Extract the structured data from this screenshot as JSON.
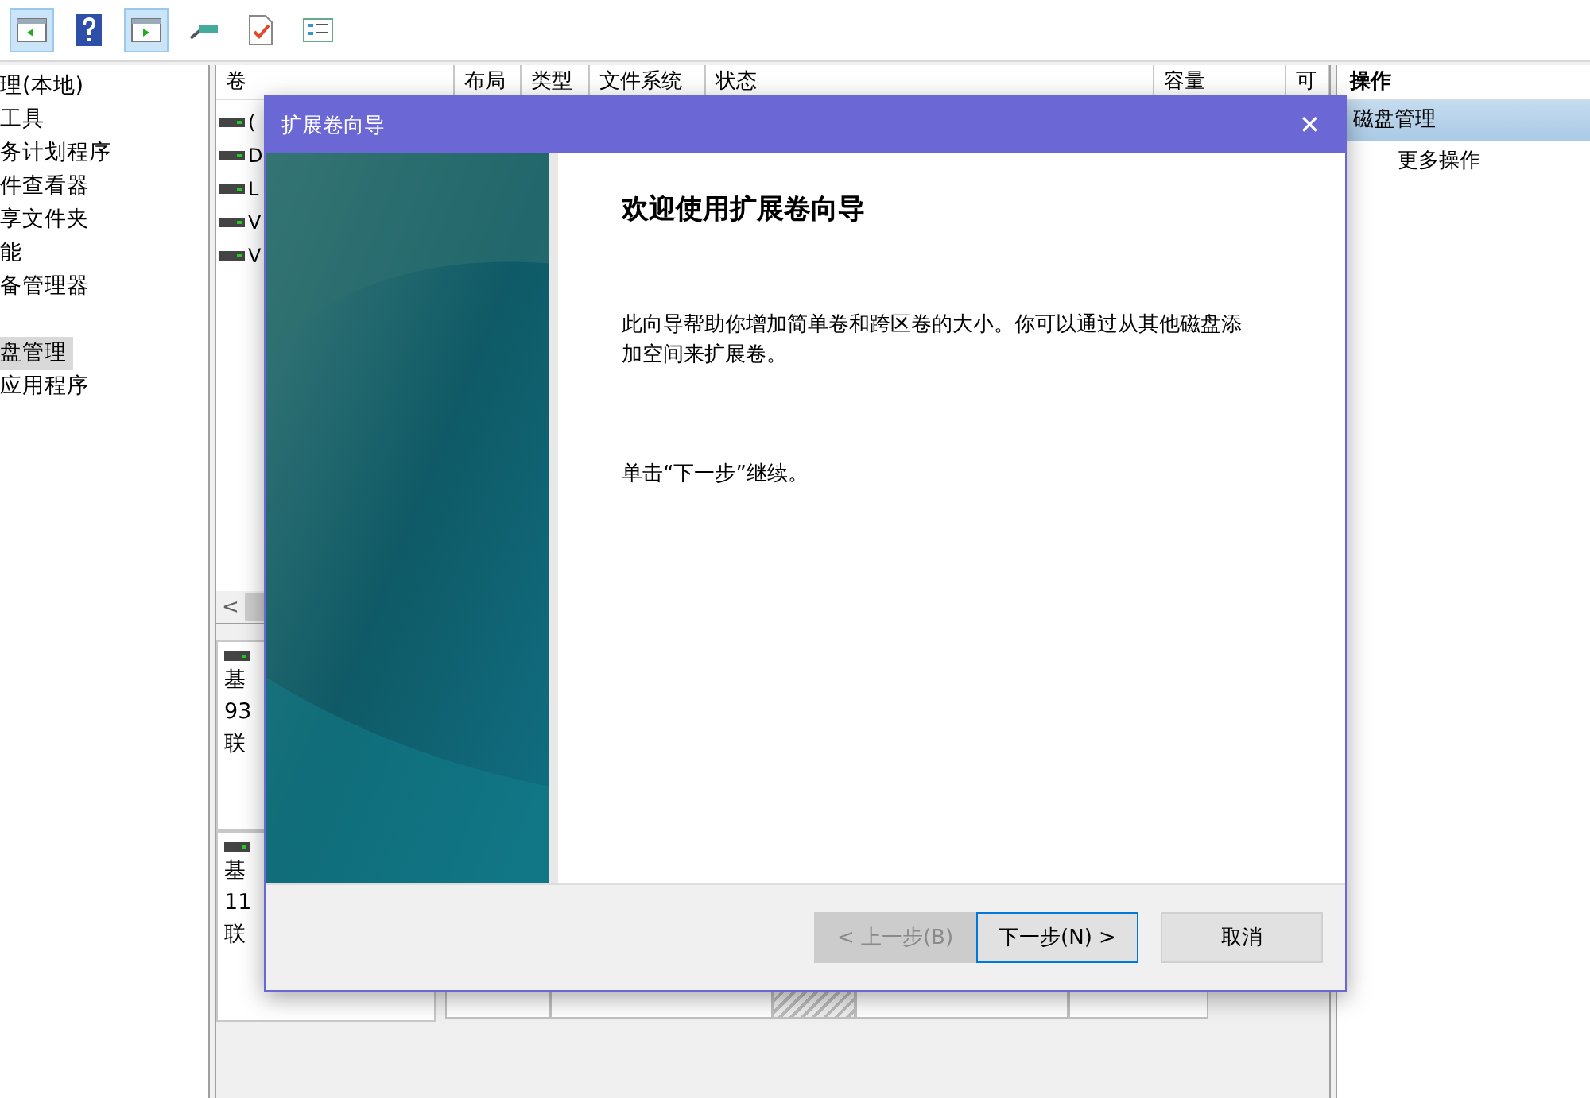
{
  "tree": {
    "groups": [
      [
        {
          "label": "理(本地)",
          "selected": false
        },
        {
          "label": "工具",
          "selected": false
        },
        {
          "label": "务计划程序",
          "selected": false
        },
        {
          "label": "件查看器",
          "selected": false
        },
        {
          "label": "享文件夹",
          "selected": false
        },
        {
          "label": "能",
          "selected": false
        },
        {
          "label": "备管理器",
          "selected": false
        }
      ],
      [
        {
          "label": "盘管理",
          "selected": true
        },
        {
          "label": "应用程序",
          "selected": false
        }
      ]
    ]
  },
  "volumes": {
    "columns": [
      "卷",
      "布局",
      "类型",
      "文件系统",
      "状态",
      "容量",
      "可"
    ],
    "rows": [
      "(",
      "D",
      "L",
      "V",
      "V"
    ],
    "scroll_left": "<"
  },
  "disks": [
    {
      "lines": [
        "基",
        "93",
        "联"
      ]
    },
    {
      "lines": [
        "基",
        "11",
        "联"
      ]
    }
  ],
  "actions": {
    "header": "操作",
    "items": [
      {
        "label": "磁盘管理",
        "selected": true
      },
      {
        "label": "更多操作",
        "selected": false
      }
    ]
  },
  "dialog": {
    "title": "扩展卷向导",
    "close": "✕",
    "heading": "欢迎使用扩展卷向导",
    "paragraphs": [
      "此向导帮助你增加简单卷和跨区卷的大小。你可以通过从其他磁盘添加空间来扩展卷。",
      "单击“下一步”继续。"
    ],
    "buttons": [
      {
        "label": "< 上一步(B)",
        "disabled": true,
        "focused": false
      },
      {
        "label": "下一步(N) >",
        "disabled": false,
        "focused": true
      },
      {
        "label": "取消",
        "disabled": false,
        "focused": false
      }
    ]
  }
}
